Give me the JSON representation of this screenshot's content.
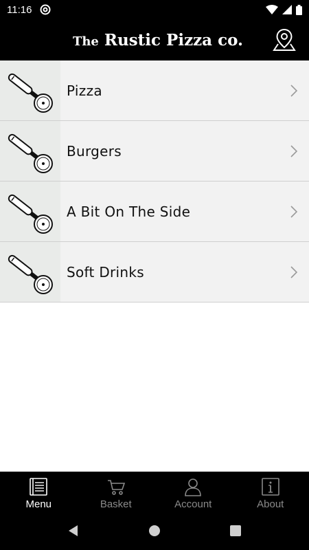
{
  "status": {
    "time": "11:16"
  },
  "header": {
    "brand_prefix": "The",
    "brand_name": "Rustic",
    "brand_word2": "Pizza",
    "brand_suffix": "co.",
    "map_icon": "map-pin-icon"
  },
  "menu": {
    "items": [
      {
        "label": "Pizza",
        "icon": "pizza-cutter-icon"
      },
      {
        "label": "Burgers",
        "icon": "pizza-cutter-icon"
      },
      {
        "label": "A Bit On The Side",
        "icon": "pizza-cutter-icon"
      },
      {
        "label": "Soft Drinks",
        "icon": "pizza-cutter-icon"
      }
    ]
  },
  "tabs": [
    {
      "label": "Menu",
      "icon": "menu-book-icon",
      "active": true
    },
    {
      "label": "Basket",
      "icon": "cart-icon",
      "active": false
    },
    {
      "label": "Account",
      "icon": "user-icon",
      "active": false
    },
    {
      "label": "About",
      "icon": "info-icon",
      "active": false
    }
  ],
  "colors": {
    "bar_bg": "#000000",
    "list_bg": "#f2f2f2",
    "tab_active": "#ffffff",
    "tab_inactive": "#8a8a8a"
  }
}
